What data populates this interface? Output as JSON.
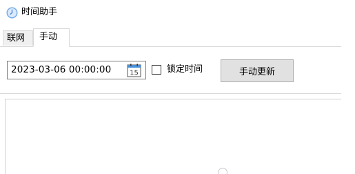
{
  "window": {
    "title": "时间助手",
    "icon": "clock-icon"
  },
  "tabs": [
    {
      "label": "联网",
      "selected": false
    },
    {
      "label": "手动",
      "selected": true
    }
  ],
  "manual": {
    "datetime_value": "2023-03-06 00:00:00",
    "calendar_icon": "calendar-icon",
    "calendar_day": "15",
    "lock_time": {
      "label": "锁定时间",
      "checked": false
    },
    "update_button_label": "手动更新",
    "log_text": ""
  },
  "colors": {
    "accent": "#5aa0e6",
    "button_bg": "#e1e1e1",
    "border": "#d9d9d9"
  }
}
